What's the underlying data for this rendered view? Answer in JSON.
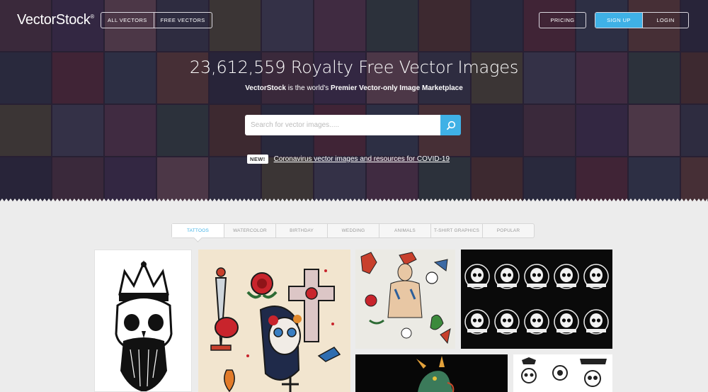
{
  "header": {
    "logo": "VectorStock",
    "logo_mark": "®",
    "nav": [
      "ALL VECTORS",
      "FREE VECTORS"
    ],
    "pricing_label": "PRICING",
    "signup_label": "SIGN UP",
    "login_label": "LOGIN"
  },
  "hero": {
    "headline": "23,612,559 Royalty Free Vector Images",
    "sub_brand": "VectorStock",
    "sub_mid": " is the world's ",
    "sub_emph": "Premier Vector-only Image Marketplace",
    "search_placeholder": "Search for vector images.....",
    "news_badge": "NEW!",
    "news_link": "Coronavirus vector images and resources for COVID-19"
  },
  "tabs": [
    "TATTOOS",
    "WATERCOLOR",
    "BIRTHDAY",
    "WEDDING",
    "ANIMALS",
    "T-SHIRT GRAPHICS",
    "POPULAR"
  ],
  "colors": {
    "accent": "#3fb1e6",
    "hero_overlay": "#261e32",
    "page_bg": "#ececec"
  },
  "icons": {
    "search": "search-icon"
  },
  "gallery": {
    "items": [
      "skull-crown-tattoo",
      "traditional-tattoo-flash",
      "sailor-tattoo-flash",
      "skull-badges-set",
      "dragon-tattoo",
      "tattoo-salon-emblems"
    ]
  }
}
